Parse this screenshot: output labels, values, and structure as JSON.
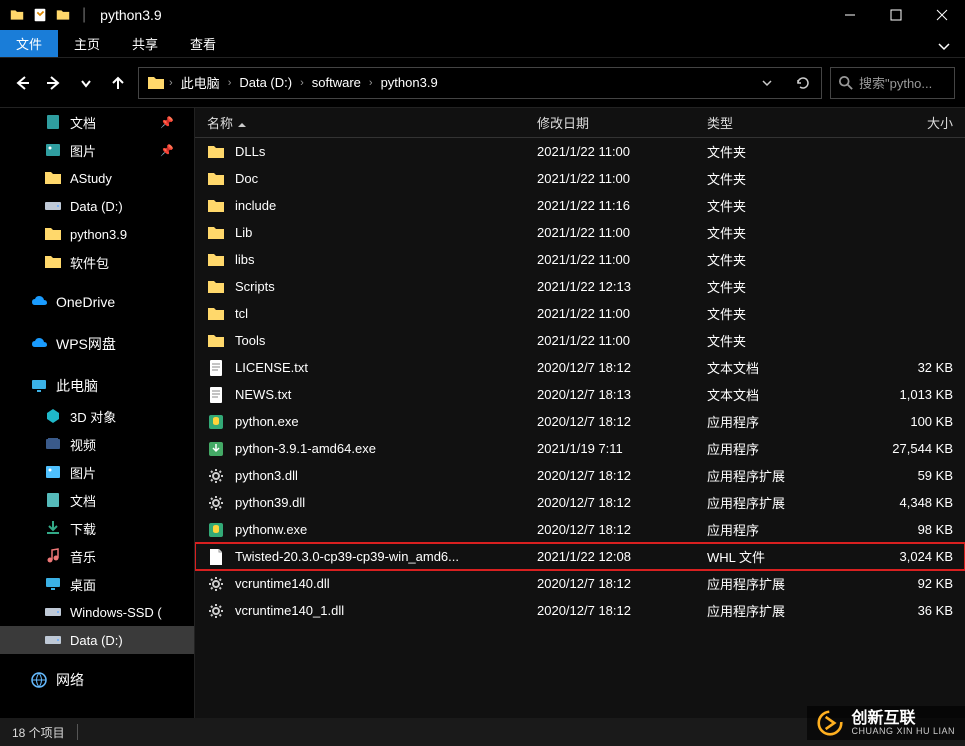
{
  "title": "python3.9",
  "ribbon": {
    "tabs": [
      "文件",
      "主页",
      "共享",
      "查看"
    ],
    "active": 0
  },
  "breadcrumb": [
    "此电脑",
    "Data (D:)",
    "software",
    "python3.9"
  ],
  "search": {
    "placeholder": "搜索\"pytho..."
  },
  "sidebar": {
    "quick": [
      {
        "label": "文档",
        "icon": "doc-teal",
        "pinned": true
      },
      {
        "label": "图片",
        "icon": "pic-teal",
        "pinned": true
      },
      {
        "label": "AStudy",
        "icon": "folder",
        "pinned": false
      },
      {
        "label": "Data (D:)",
        "icon": "drive",
        "pinned": false
      },
      {
        "label": "python3.9",
        "icon": "folder",
        "pinned": false
      },
      {
        "label": "软件包",
        "icon": "folder",
        "pinned": false
      }
    ],
    "onedrive": "OneDrive",
    "wps": "WPS网盘",
    "thispc": "此电脑",
    "thispc_items": [
      {
        "label": "3D 对象",
        "icon": "3d"
      },
      {
        "label": "视频",
        "icon": "video"
      },
      {
        "label": "图片",
        "icon": "pic"
      },
      {
        "label": "文档",
        "icon": "doc"
      },
      {
        "label": "下载",
        "icon": "download"
      },
      {
        "label": "音乐",
        "icon": "music"
      },
      {
        "label": "桌面",
        "icon": "desktop"
      },
      {
        "label": "Windows-SSD (",
        "icon": "drive"
      },
      {
        "label": "Data (D:)",
        "icon": "drive",
        "selected": true
      }
    ],
    "network": "网络"
  },
  "columns": {
    "name": "名称",
    "date": "修改日期",
    "type": "类型",
    "size": "大小"
  },
  "files": [
    {
      "name": "DLLs",
      "date": "2021/1/22 11:00",
      "type": "文件夹",
      "size": "",
      "icon": "folder"
    },
    {
      "name": "Doc",
      "date": "2021/1/22 11:00",
      "type": "文件夹",
      "size": "",
      "icon": "folder"
    },
    {
      "name": "include",
      "date": "2021/1/22 11:16",
      "type": "文件夹",
      "size": "",
      "icon": "folder"
    },
    {
      "name": "Lib",
      "date": "2021/1/22 11:00",
      "type": "文件夹",
      "size": "",
      "icon": "folder"
    },
    {
      "name": "libs",
      "date": "2021/1/22 11:00",
      "type": "文件夹",
      "size": "",
      "icon": "folder"
    },
    {
      "name": "Scripts",
      "date": "2021/1/22 12:13",
      "type": "文件夹",
      "size": "",
      "icon": "folder"
    },
    {
      "name": "tcl",
      "date": "2021/1/22 11:00",
      "type": "文件夹",
      "size": "",
      "icon": "folder"
    },
    {
      "name": "Tools",
      "date": "2021/1/22 11:00",
      "type": "文件夹",
      "size": "",
      "icon": "folder"
    },
    {
      "name": "LICENSE.txt",
      "date": "2020/12/7 18:12",
      "type": "文本文档",
      "size": "32 KB",
      "icon": "txt"
    },
    {
      "name": "NEWS.txt",
      "date": "2020/12/7 18:13",
      "type": "文本文档",
      "size": "1,013 KB",
      "icon": "txt"
    },
    {
      "name": "python.exe",
      "date": "2020/12/7 18:12",
      "type": "应用程序",
      "size": "100 KB",
      "icon": "exe-py"
    },
    {
      "name": "python-3.9.1-amd64.exe",
      "date": "2021/1/19 7:11",
      "type": "应用程序",
      "size": "27,544 KB",
      "icon": "exe-install"
    },
    {
      "name": "python3.dll",
      "date": "2020/12/7 18:12",
      "type": "应用程序扩展",
      "size": "59 KB",
      "icon": "dll"
    },
    {
      "name": "python39.dll",
      "date": "2020/12/7 18:12",
      "type": "应用程序扩展",
      "size": "4,348 KB",
      "icon": "dll"
    },
    {
      "name": "pythonw.exe",
      "date": "2020/12/7 18:12",
      "type": "应用程序",
      "size": "98 KB",
      "icon": "exe-py"
    },
    {
      "name": "Twisted-20.3.0-cp39-cp39-win_amd6...",
      "date": "2021/1/22 12:08",
      "type": "WHL 文件",
      "size": "3,024 KB",
      "icon": "file",
      "highlighted": true
    },
    {
      "name": "vcruntime140.dll",
      "date": "2020/12/7 18:12",
      "type": "应用程序扩展",
      "size": "92 KB",
      "icon": "dll"
    },
    {
      "name": "vcruntime140_1.dll",
      "date": "2020/12/7 18:12",
      "type": "应用程序扩展",
      "size": "36 KB",
      "icon": "dll"
    }
  ],
  "status": "18 个项目",
  "watermark": {
    "main": "创新互联",
    "sub": "CHUANG XIN HU LIAN"
  }
}
